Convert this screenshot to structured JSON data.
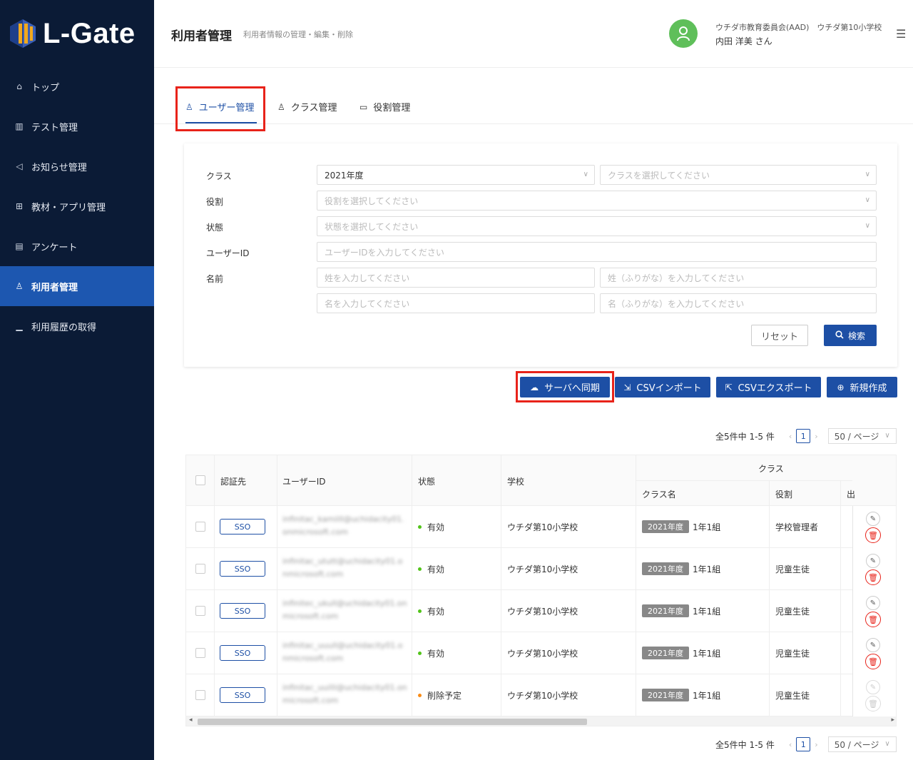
{
  "brand": {
    "name": "L-Gate"
  },
  "sidebar": {
    "items": [
      {
        "label": "トップ",
        "icon": "home-icon"
      },
      {
        "label": "テスト管理",
        "icon": "book-icon"
      },
      {
        "label": "お知らせ管理",
        "icon": "megaphone-icon"
      },
      {
        "label": "教材・アプリ管理",
        "icon": "plus-square-icon"
      },
      {
        "label": "アンケート",
        "icon": "clipboard-icon"
      },
      {
        "label": "利用者管理",
        "icon": "users-icon",
        "active": true
      },
      {
        "label": "利用履歴の取得",
        "icon": "bar-chart-icon"
      }
    ]
  },
  "header": {
    "title": "利用者管理",
    "subtitle": "利用者情報の管理・編集・削除",
    "user_org": "ウチダ市教育委員会(AAD)　ウチダ第10小学校",
    "user_name": "内田 洋美 さん",
    "avatar_color": "#5fbf5a"
  },
  "tabs": [
    {
      "label": "ユーザー管理",
      "icon": "users-icon",
      "active": true
    },
    {
      "label": "クラス管理",
      "icon": "user-icon"
    },
    {
      "label": "役割管理",
      "icon": "id-card-icon"
    }
  ],
  "filters": {
    "class_label": "クラス",
    "class_year_value": "2021年度",
    "class_placeholder": "クラスを選択してください",
    "role_label": "役割",
    "role_placeholder": "役割を選択してください",
    "status_label": "状態",
    "status_placeholder": "状態を選択してください",
    "userid_label": "ユーザーID",
    "userid_placeholder": "ユーザーIDを入力してください",
    "name_label": "名前",
    "lastname_placeholder": "姓を入力してください",
    "lastname_kana_placeholder": "姓（ふりがな）を入力してください",
    "firstname_placeholder": "名を入力してください",
    "firstname_kana_placeholder": "名（ふりがな）を入力してください",
    "reset_label": "リセット",
    "search_label": "検索"
  },
  "actions": {
    "sync_label": "サーバへ同期",
    "csv_import_label": "CSVインポート",
    "csv_export_label": "CSVエクスポート",
    "new_label": "新規作成"
  },
  "pagination": {
    "summary": "全5件中 1-5 件",
    "page": "1",
    "per_page": "50 / ページ"
  },
  "table": {
    "headers": {
      "auth": "認証先",
      "user_id": "ユーザーID",
      "status": "状態",
      "school": "学校",
      "class_group": "クラス",
      "class_name": "クラス名",
      "role": "役割",
      "extra": "出"
    },
    "rows": [
      {
        "auth": "SSO",
        "user_id": "infinitac_kamiill@uchidacity01.onmicrosoft.com",
        "status": "有効",
        "status_color": "#52c41a",
        "school": "ウチダ第10小学校",
        "year": "2021年度",
        "class": "1年1組",
        "role": "学校管理者"
      },
      {
        "auth": "SSO",
        "user_id": "infinitac_ututt@uchidacity01.onmicrosoft.com",
        "status": "有効",
        "status_color": "#52c41a",
        "school": "ウチダ第10小学校",
        "year": "2021年度",
        "class": "1年1組",
        "role": "児童生徒"
      },
      {
        "auth": "SSO",
        "user_id": "infinitec_ukull@uchidacity01.onmicrosoft.com",
        "status": "有効",
        "status_color": "#52c41a",
        "school": "ウチダ第10小学校",
        "year": "2021年度",
        "class": "1年1組",
        "role": "児童生徒"
      },
      {
        "auth": "SSO",
        "user_id": "infinitac_uuull@uchidacity01.onmicrosoft.com",
        "status": "有効",
        "status_color": "#52c41a",
        "school": "ウチダ第10小学校",
        "year": "2021年度",
        "class": "1年1組",
        "role": "児童生徒"
      },
      {
        "auth": "SSO",
        "user_id": "infinitac_uuilli@uchidacity01.onmicrosoft.com",
        "status": "削除予定",
        "status_color": "#fa8c16",
        "school": "ウチダ第10小学校",
        "year": "2021年度",
        "class": "1年1組",
        "role": "児童生徒"
      }
    ]
  },
  "colors": {
    "primary": "#1d4fa5",
    "sidebar_bg": "#0b1b36",
    "sidebar_active": "#1d57b0",
    "highlight_red": "#e8231a"
  }
}
